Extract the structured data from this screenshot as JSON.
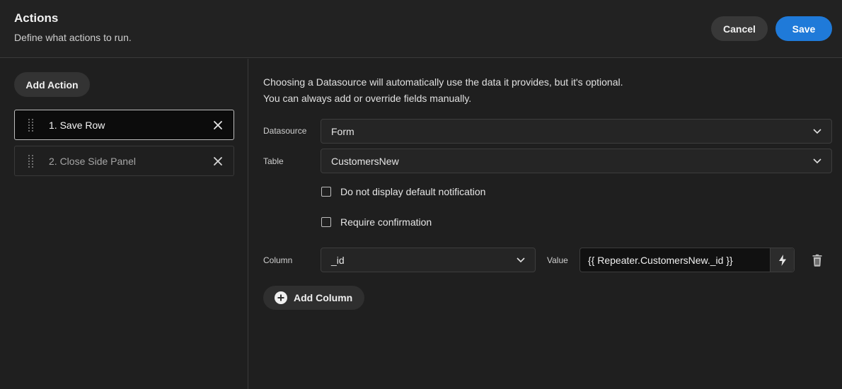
{
  "header": {
    "title": "Actions",
    "subtitle": "Define what actions to run.",
    "cancel_label": "Cancel",
    "save_label": "Save"
  },
  "sidebar": {
    "add_action_label": "Add Action",
    "actions": [
      {
        "label": "1. Save Row",
        "selected": true
      },
      {
        "label": "2. Close Side Panel",
        "selected": false
      }
    ]
  },
  "main": {
    "info_line1": "Choosing a Datasource will automatically use the data it provides, but it's optional.",
    "info_line2": "You can always add or override fields manually.",
    "datasource": {
      "label": "Datasource",
      "value": "Form"
    },
    "table": {
      "label": "Table",
      "value": "CustomersNew"
    },
    "checkboxes": [
      {
        "label": "Do not display default notification",
        "checked": false
      },
      {
        "label": "Require confirmation",
        "checked": false
      }
    ],
    "column_row": {
      "column_label": "Column",
      "column_value": "_id",
      "value_label": "Value",
      "value": "{{ Repeater.CustomersNew._id }}"
    },
    "add_column_label": "Add Column"
  },
  "colors": {
    "background": "#1f1f1f",
    "accent": "#1f7ad9",
    "border": "#3a3a3a"
  },
  "icons": [
    "drag-handle-icon",
    "close-icon",
    "chevron-down-icon",
    "lightning-bolt-icon",
    "trash-icon",
    "plus-circle-icon"
  ]
}
